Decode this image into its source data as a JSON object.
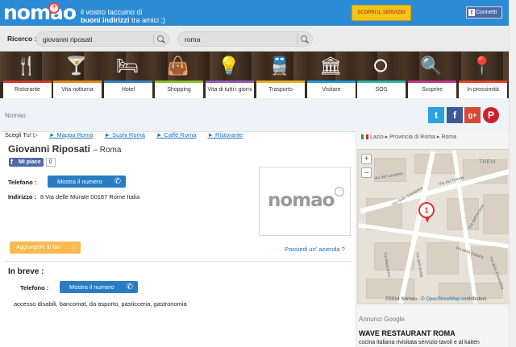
{
  "header": {
    "logo": "nomao",
    "tagline_line1": "il vostro taccuino di",
    "tagline_bold": "buoni indirizzi",
    "tagline_rest": " tra amici ;)",
    "discover_button": "SCOPRI IL SERVIZIO",
    "connect_button": "Connetti"
  },
  "search": {
    "label": "Ricerco :",
    "query": "giovanni riposati",
    "location": "roma"
  },
  "categories": [
    {
      "label": "Ristorante",
      "icon": "fork-knife-icon",
      "glyph": "🍴",
      "color": "#d23b2a"
    },
    {
      "label": "Vita notturna",
      "icon": "cocktail-icon",
      "glyph": "🍸",
      "color": "#e08a1f"
    },
    {
      "label": "Hotel",
      "icon": "bed-icon",
      "glyph": "🛏",
      "color": "#3b82c4"
    },
    {
      "label": "Shopping",
      "icon": "shopping-bag-icon",
      "glyph": "👜",
      "color": "#8bbd2b"
    },
    {
      "label": "Vita di tutti i giorni",
      "icon": "lightbulb-icon",
      "glyph": "💡",
      "color": "#9b59b6"
    },
    {
      "label": "Trasporto",
      "icon": "train-icon",
      "glyph": "🚆",
      "color": "#e0b11f"
    },
    {
      "label": "Visitare",
      "icon": "monument-icon",
      "glyph": "🏛",
      "color": "#1f9ad6"
    },
    {
      "label": "SOS",
      "icon": "lifebuoy-icon",
      "glyph": "⭘",
      "color": "#2fb5a0"
    },
    {
      "label": "Scoprire",
      "icon": "magnifier-icon",
      "glyph": "🔍",
      "color": "#c2388f"
    },
    {
      "label": "In prossimità",
      "icon": "location-pin-icon",
      "glyph": "📍",
      "color": "#e2452f"
    }
  ],
  "breadcrumb": "Nomao",
  "links": {
    "intro": "Scegli Tu!",
    "items": [
      "Mappa Roma",
      "Sushi Roma",
      "Caffè Roma",
      "Ristorante"
    ]
  },
  "business": {
    "name": "Giovanni Riposati",
    "city": "– Roma",
    "like_label": "Mi piace",
    "like_count": "0",
    "phone_label": "Telefono :",
    "show_number": "Mostra il numero",
    "address_label": "Indirizzo :",
    "address": "8 Via delle Murate 00187 Rome Italia",
    "logo_text": "nomao",
    "fav_button": "Aggiungere ai fav",
    "own_link": "Possiedi un' azienda ?",
    "brief_title": "In breve :",
    "brief_phone_label": "Telefono :",
    "brief_show_number": "Mostra il numero",
    "services": "accesso disabili, bancomat, da asporto, pasticceria, gastronomia"
  },
  "right": {
    "region": "Lazio",
    "province": "Provincia di Roma",
    "city": "Roma",
    "zoom_in": "+",
    "zoom_out": "–",
    "marker": "1",
    "attrib_prefix": "©2014 Nomao - © ",
    "attrib_link": "OpenStreetMap",
    "attrib_suffix": " contributors",
    "streets": [
      "Via del Tritone",
      "Via della Stamperia",
      "Via della Panetteria",
      "Via dell'Umiltà",
      "Via della Dataria",
      "Via del Lavatore",
      "TREVI",
      "Via Mazzarino",
      "Via dell'Arcione"
    ],
    "ads_label": "Annunci Google",
    "ad_title": "WAVE RESTAURANT ROMA",
    "ad_desc": "cucina italiana rivisitata servizio tavoli e al kaiten"
  }
}
